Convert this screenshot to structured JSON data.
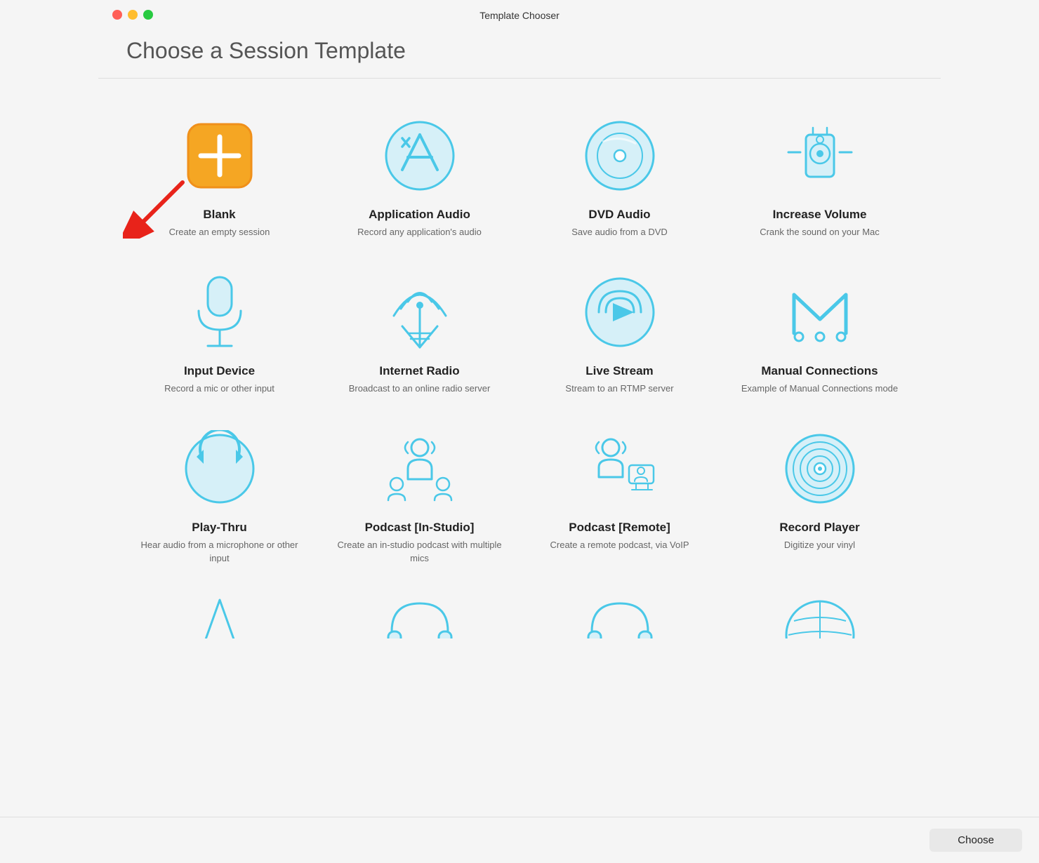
{
  "window": {
    "title": "Template Chooser",
    "traffic_lights": {
      "close": "close",
      "minimize": "minimize",
      "maximize": "maximize"
    }
  },
  "header": {
    "title": "Choose a Session Template"
  },
  "templates": [
    {
      "id": "blank",
      "title": "Blank",
      "desc": "Create an empty session",
      "icon": "blank"
    },
    {
      "id": "application-audio",
      "title": "Application Audio",
      "desc": "Record any application's audio",
      "icon": "application-audio"
    },
    {
      "id": "dvd-audio",
      "title": "DVD Audio",
      "desc": "Save audio from a DVD",
      "icon": "dvd-audio"
    },
    {
      "id": "increase-volume",
      "title": "Increase Volume",
      "desc": "Crank the sound on your Mac",
      "icon": "increase-volume"
    },
    {
      "id": "input-device",
      "title": "Input Device",
      "desc": "Record a mic or other input",
      "icon": "input-device"
    },
    {
      "id": "internet-radio",
      "title": "Internet Radio",
      "desc": "Broadcast to an online radio server",
      "icon": "internet-radio"
    },
    {
      "id": "live-stream",
      "title": "Live Stream",
      "desc": "Stream to an RTMP server",
      "icon": "live-stream"
    },
    {
      "id": "manual-connections",
      "title": "Manual Connections",
      "desc": "Example of Manual Connections mode",
      "icon": "manual-connections"
    },
    {
      "id": "play-thru",
      "title": "Play-Thru",
      "desc": "Hear audio from a microphone or other input",
      "icon": "play-thru"
    },
    {
      "id": "podcast-in-studio",
      "title": "Podcast [In-Studio]",
      "desc": "Create an in-studio podcast with multiple mics",
      "icon": "podcast-in-studio"
    },
    {
      "id": "podcast-remote",
      "title": "Podcast [Remote]",
      "desc": "Create a remote podcast, via VoIP",
      "icon": "podcast-remote"
    },
    {
      "id": "record-player",
      "title": "Record Player",
      "desc": "Digitize your vinyl",
      "icon": "record-player"
    },
    {
      "id": "row4-1",
      "title": "",
      "desc": "",
      "icon": "row4-1"
    },
    {
      "id": "row4-2",
      "title": "",
      "desc": "",
      "icon": "row4-2"
    },
    {
      "id": "row4-3",
      "title": "",
      "desc": "",
      "icon": "row4-3"
    },
    {
      "id": "row4-4",
      "title": "",
      "desc": "",
      "icon": "row4-4"
    }
  ],
  "buttons": {
    "choose": "Choose"
  },
  "colors": {
    "accent": "#4ac8e8",
    "accent_light": "#c8eef8",
    "blank_bg": "#f5a623",
    "blank_border": "#f0901a"
  }
}
